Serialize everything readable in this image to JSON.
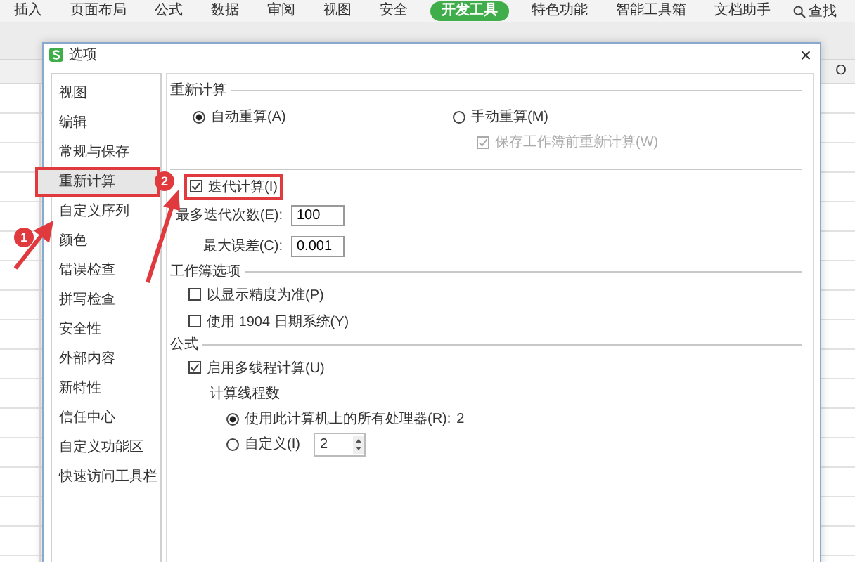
{
  "ribbon": {
    "tabs": [
      {
        "label": "插入",
        "selected": false
      },
      {
        "label": "页面布局",
        "selected": false
      },
      {
        "label": "公式",
        "selected": false
      },
      {
        "label": "数据",
        "selected": false
      },
      {
        "label": "审阅",
        "selected": false
      },
      {
        "label": "视图",
        "selected": false
      },
      {
        "label": "安全",
        "selected": false
      },
      {
        "label": "开发工具",
        "selected": true
      },
      {
        "label": "特色功能",
        "selected": false
      },
      {
        "label": "智能工具箱",
        "selected": false
      },
      {
        "label": "文档助手",
        "selected": false
      }
    ],
    "search": {
      "label": "查找"
    }
  },
  "sheet": {
    "column_header": "O"
  },
  "dialog": {
    "title": "选项",
    "close": "×",
    "sidebar": {
      "items": [
        {
          "label": "视图",
          "selected": false,
          "highlighted": false
        },
        {
          "label": "编辑",
          "selected": false,
          "highlighted": false
        },
        {
          "label": "常规与保存",
          "selected": false,
          "highlighted": false
        },
        {
          "label": "重新计算",
          "selected": true,
          "highlighted": true
        },
        {
          "label": "自定义序列",
          "selected": false,
          "highlighted": false
        },
        {
          "label": "颜色",
          "selected": false,
          "highlighted": false
        },
        {
          "label": "错误检查",
          "selected": false,
          "highlighted": false
        },
        {
          "label": "拼写检查",
          "selected": false,
          "highlighted": false
        },
        {
          "label": "安全性",
          "selected": false,
          "highlighted": false
        },
        {
          "label": "外部内容",
          "selected": false,
          "highlighted": false
        },
        {
          "label": "新特性",
          "selected": false,
          "highlighted": false
        },
        {
          "label": "信任中心",
          "selected": false,
          "highlighted": false
        },
        {
          "label": "自定义功能区",
          "selected": false,
          "highlighted": false
        },
        {
          "label": "快速访问工具栏",
          "selected": false,
          "highlighted": false
        }
      ]
    },
    "sections": [
      {
        "title": "重新计算",
        "rows": [
          {
            "kind": "radio-pair",
            "options": [
              {
                "label": "自动重算(A)",
                "selected": true
              },
              {
                "label": "手动重算(M)",
                "selected": false
              }
            ]
          },
          {
            "kind": "sub-check",
            "label": "保存工作簿前重新计算(W)",
            "checked": true,
            "disabled": true
          }
        ]
      },
      {
        "rows": [
          {
            "kind": "check",
            "label": "迭代计算(I)",
            "checked": true,
            "highlighted": true
          },
          {
            "kind": "field",
            "label": "最多迭代次数(E):",
            "value": "100"
          },
          {
            "kind": "field",
            "label": "最大误差(C):",
            "value": "0.001"
          }
        ]
      },
      {
        "title": "工作簿选项",
        "rows": [
          {
            "kind": "check",
            "label": "以显示精度为准(P)",
            "checked": false,
            "highlighted": false
          },
          {
            "kind": "check",
            "label": "使用 1904 日期系统(Y)",
            "checked": false,
            "highlighted": false
          }
        ]
      },
      {
        "title": "公式",
        "rows": [
          {
            "kind": "check",
            "label": "启用多线程计算(U)",
            "checked": true,
            "highlighted": false
          },
          {
            "kind": "caption",
            "label": "计算线程数"
          },
          {
            "kind": "radio",
            "label": "使用此计算机上的所有处理器(R):",
            "value": "2",
            "selected": true
          },
          {
            "kind": "radio-spin",
            "label": "自定义(I)",
            "value": "2",
            "selected": false
          }
        ]
      }
    ]
  },
  "annotations": [
    {
      "label": "1"
    },
    {
      "label": "2"
    }
  ]
}
